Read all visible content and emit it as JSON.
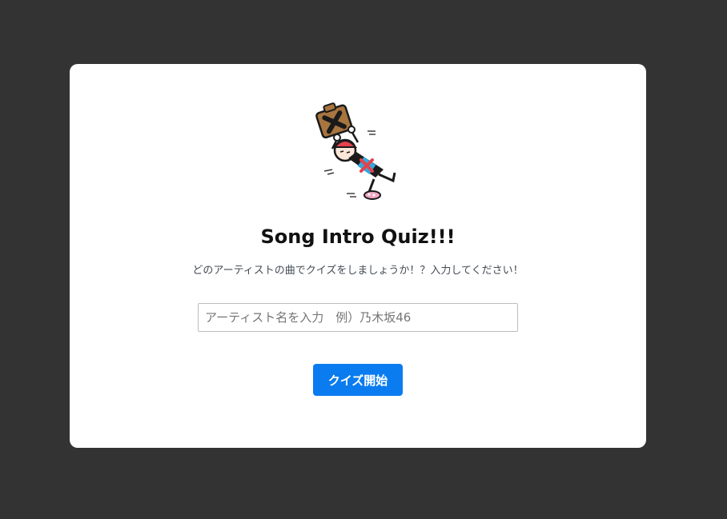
{
  "quiz": {
    "title": "Song Intro Quiz!!!",
    "subtitle": "どのアーティストの曲でクイズをしましょうか！？入力してください！",
    "artist_input": {
      "placeholder": "アーティスト名を入力　例）乃木坂46",
      "value": ""
    },
    "start_button_label": "クイズ開始"
  },
  "mascot": {
    "icon": "breakdancing-character-illustration"
  },
  "colors": {
    "page_background": "#333333",
    "card_background": "#ffffff",
    "button_accent": "#0a7cf0"
  }
}
